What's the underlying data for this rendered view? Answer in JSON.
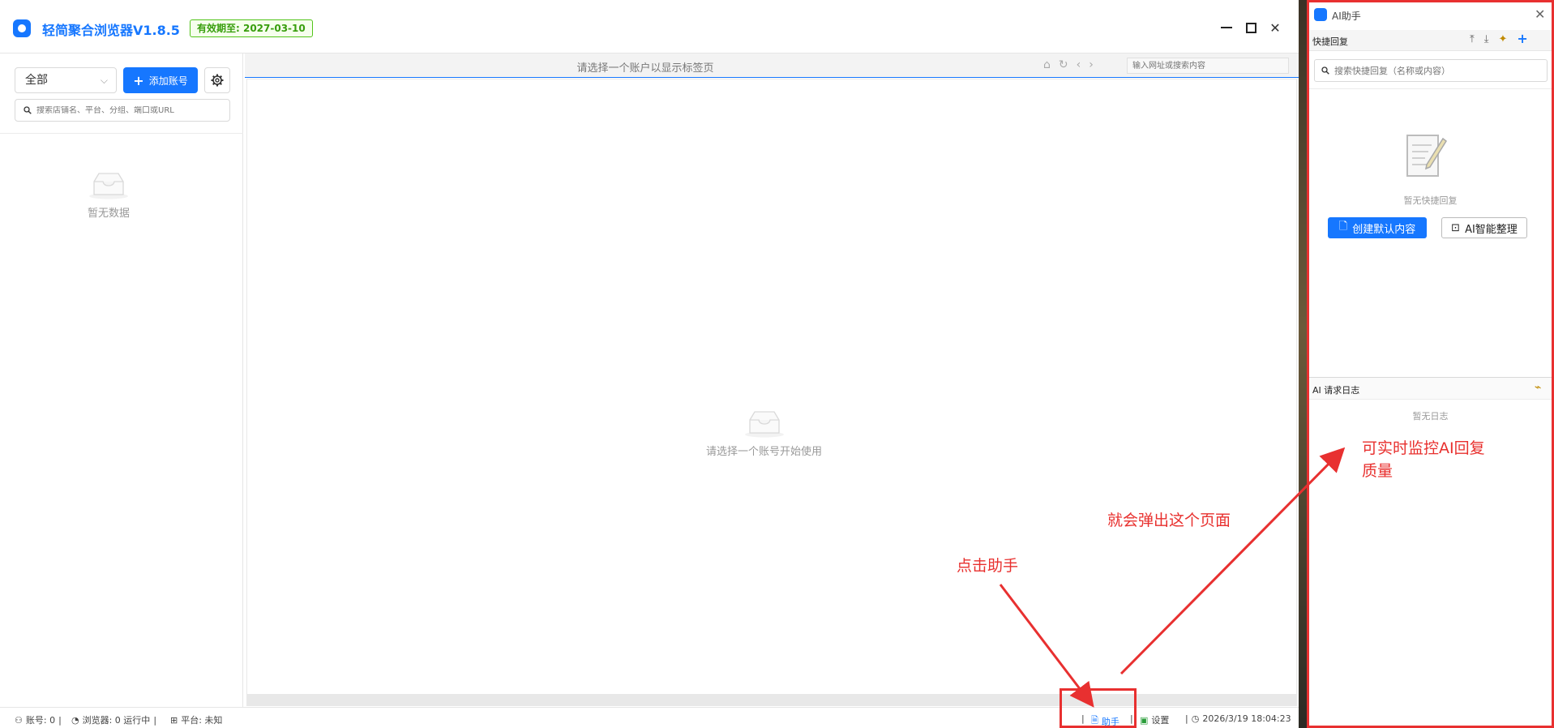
{
  "app": {
    "title": "轻简聚合浏览器V1.8.5",
    "expire_badge": "有效期至: 2027-03-10"
  },
  "sidebar": {
    "filter_value": "全部",
    "add_account_label": "添加账号",
    "search_placeholder": "搜索店铺名、平台、分组、端口或URL",
    "empty_text": "暂无数据"
  },
  "content": {
    "tab_hint": "请选择一个账户以显示标签页",
    "url_placeholder": "输入网址或搜索内容",
    "empty_text": "请选择一个账号开始使用"
  },
  "statusbar": {
    "accounts": "账号: 0",
    "browsers": "浏览器: 0 运行中",
    "platform": "平台: 未知",
    "assistant": "助手",
    "settings": "设置",
    "datetime": "2026/3/19 18:04:23",
    "sep": "|"
  },
  "ai_panel": {
    "title": "AI助手",
    "quick_reply_title": "快捷回复",
    "search_placeholder": "搜索快捷回复（名称或内容）",
    "empty_text": "暂无快捷回复",
    "create_default_label": "创建默认内容",
    "ai_organize_label": "AI智能整理",
    "log_title": "AI 请求日志",
    "log_empty": "暂无日志"
  },
  "annotations": {
    "click_assistant": "点击助手",
    "popup_page": "就会弹出这个页面",
    "monitor_line1": "可实时监控AI回复",
    "monitor_line2": "质量",
    "color": "#e8302e"
  },
  "colors": {
    "accent": "#1677ff",
    "badge_green": "#52c41a",
    "annotation_red": "#e83030"
  }
}
